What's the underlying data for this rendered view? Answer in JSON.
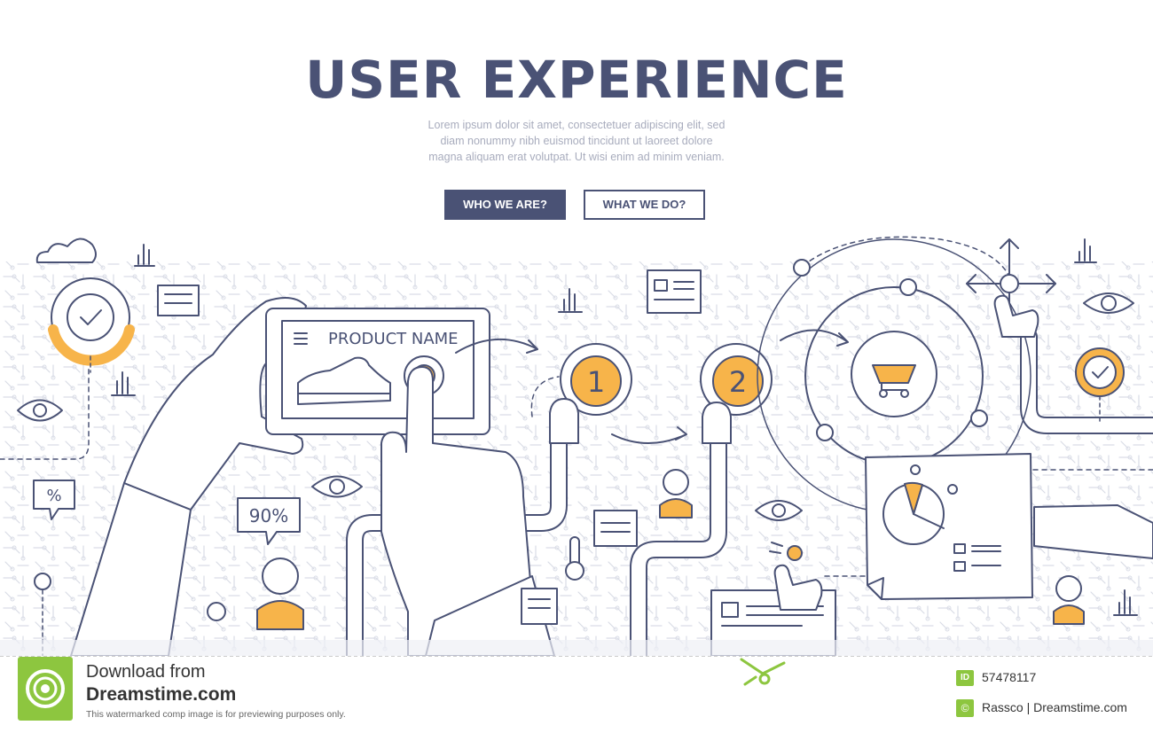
{
  "hero": {
    "title": "USER EXPERIENCE",
    "lorem_lines": [
      "Lorem ipsum dolor sit amet, consectetuer adipiscing elit, sed",
      "diam nonummy nibh euismod tincidunt ut laoreet dolore",
      "magna aliquam erat volutpat. Ut wisi enim ad minim veniam."
    ],
    "buttons": {
      "primary": "WHO WE ARE?",
      "secondary": "WHAT WE DO?"
    }
  },
  "illustration": {
    "product_label": "PRODUCT NAME",
    "step_one": "1",
    "step_two": "2",
    "percent_badge": "%",
    "percent_value": "90%",
    "colors": {
      "ink": "#4a5275",
      "accent": "#f7b44a",
      "fill": "#ffffff",
      "pattern": "#d9dce6"
    },
    "icons": [
      "eye-icon",
      "cloud-icon",
      "checkmark-icon",
      "bar-chart-icon",
      "shopping-cart-icon",
      "pie-chart-icon",
      "thermometer-icon",
      "avatar-icon",
      "move-arrows-icon",
      "pointing-hand-icon"
    ]
  },
  "footer": {
    "download_line": "Download from",
    "site": "Dreamstime.com",
    "note": "This watermarked comp image is for previewing purposes only.",
    "id_badge": "ID",
    "id_number": "57478117",
    "copyright_symbol": "©",
    "credit": "Rassco | Dreamstime.com"
  }
}
